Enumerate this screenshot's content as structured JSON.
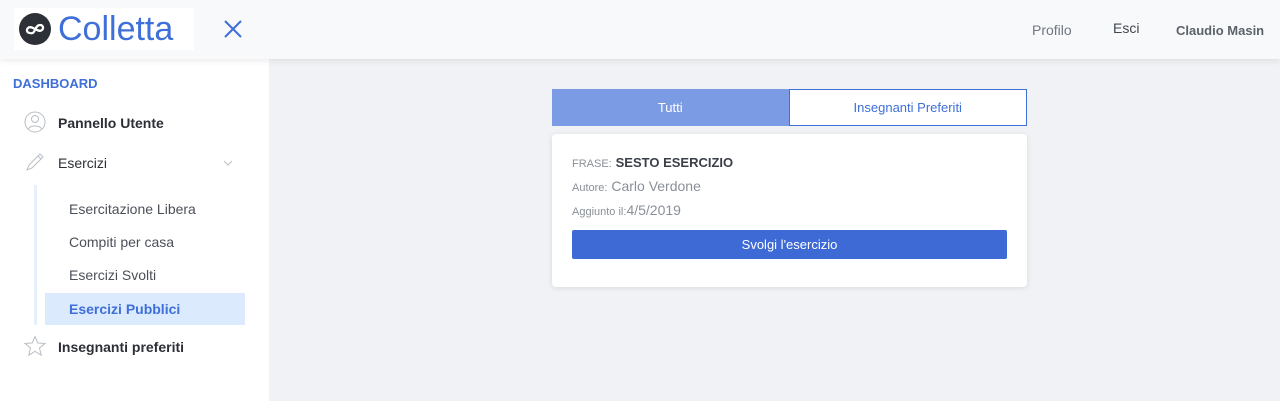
{
  "header": {
    "logo_text": "Colletta",
    "nav": {
      "profilo": "Profilo",
      "esci": "Esci",
      "user": "Claudio Masin"
    },
    "colors": {
      "brand": "#3f6fd8",
      "background": "#f8f9fb"
    }
  },
  "sidebar": {
    "title": "DASHBOARD",
    "items": [
      {
        "label": "Pannello Utente",
        "icon": "user-icon"
      },
      {
        "label": "Esercizi",
        "icon": "pencil-icon"
      },
      {
        "label": "Insegnanti preferiti",
        "icon": "star-icon"
      }
    ],
    "subitems": [
      {
        "label": "Esercitazione Libera"
      },
      {
        "label": "Compiti per casa"
      },
      {
        "label": "Esercizi Svolti"
      },
      {
        "label": "Esercizi Pubblici",
        "active": true
      }
    ]
  },
  "main": {
    "tabs": [
      {
        "label": "Tutti",
        "active": true
      },
      {
        "label": "Insegnanti Preferiti",
        "active": false
      }
    ],
    "card": {
      "frase_key": "FRASE:",
      "frase_value": "SESTO ESERCIZIO",
      "autore_key": "Autore:",
      "autore_value": "Carlo Verdone",
      "aggiunto_key": "Aggiunto il:",
      "aggiunto_value": "4/5/2019",
      "button_label": "Svolgi l'esercizio"
    },
    "colors": {
      "accent": "#3e6ad6",
      "tab_active": "#7b9be4",
      "background": "#f0f2f5"
    }
  }
}
